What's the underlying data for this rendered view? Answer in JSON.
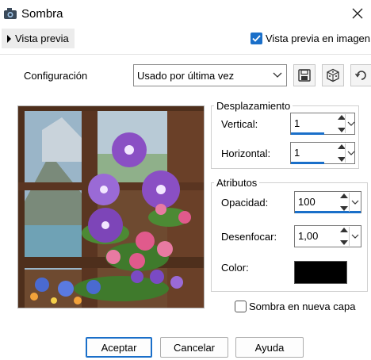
{
  "window": {
    "title": "Sombra",
    "icon": "camera-app-icon",
    "close_icon": "close-icon"
  },
  "preview": {
    "toggle_label": "Vista previa",
    "image_check_label": "Vista previa en imagen",
    "image_checked": true
  },
  "config": {
    "label": "Configuración",
    "selected": "Usado por última vez",
    "icons": [
      "save-icon",
      "dice-icon",
      "reset-icon"
    ]
  },
  "displacement": {
    "title": "Desplazamiento",
    "vertical_label": "Vertical:",
    "vertical_value": "1",
    "horizontal_label": "Horizontal:",
    "horizontal_value": "1"
  },
  "attributes": {
    "title": "Atributos",
    "opacity_label": "Opacidad:",
    "opacity_value": "100",
    "blur_label": "Desenfocar:",
    "blur_value": "1,00",
    "color_label": "Color:",
    "color_value": "#000000"
  },
  "shadow_new_layer": {
    "label": "Sombra en nueva capa",
    "checked": false
  },
  "buttons": {
    "accept": "Aceptar",
    "cancel": "Cancelar",
    "help": "Ayuda"
  },
  "colors": {
    "accent": "#1a6fc9",
    "swatch": "#000000"
  }
}
